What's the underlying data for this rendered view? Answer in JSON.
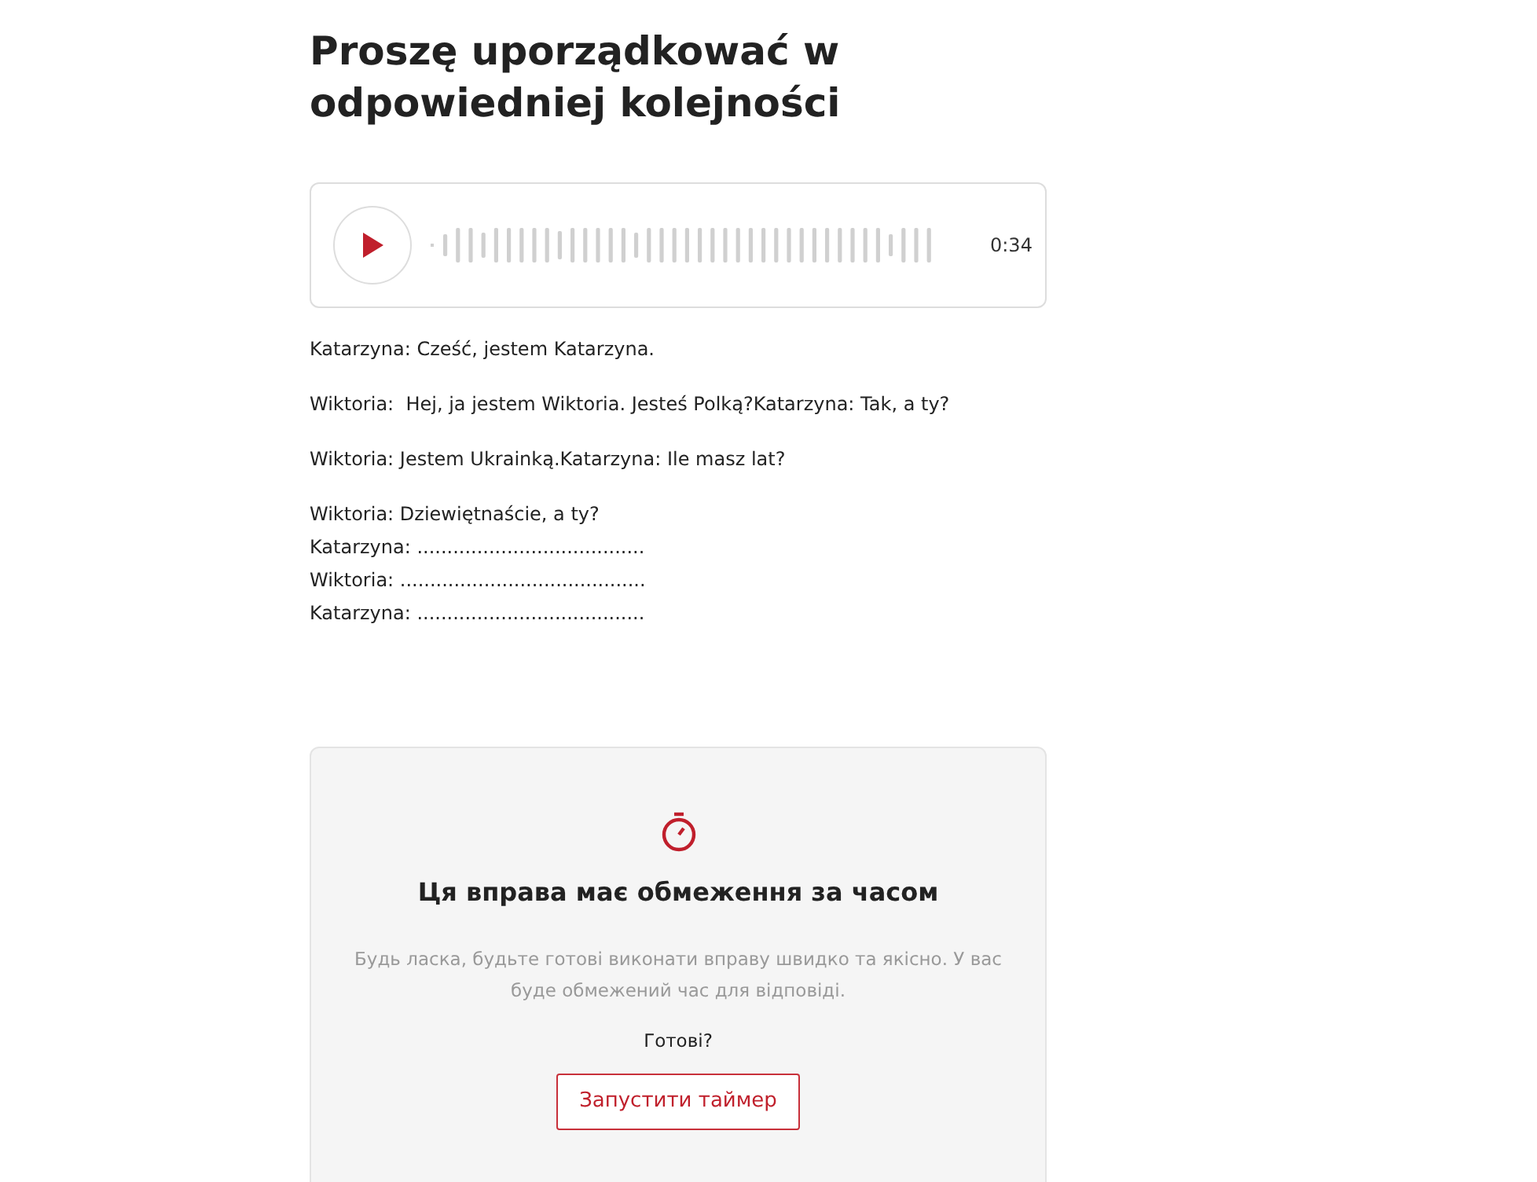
{
  "title": "Proszę uporządkować w odpowiedniej kolejności",
  "audio": {
    "duration": "0:34"
  },
  "paragraphs": [
    {
      "lines": [
        "Katarzyna: Cześć, jestem Katarzyna."
      ]
    },
    {
      "lines": [
        "Wiktoria:  Hej, ja jestem Wiktoria. Jesteś Polką?Katarzyna: Tak, a ty?"
      ]
    },
    {
      "lines": [
        "Wiktoria: Jestem Ukrainką.Katarzyna: Ile masz lat?"
      ]
    },
    {
      "lines": [
        "Wiktoria: Dziewiętnaście, a ty?",
        "Katarzyna: ......................................",
        "Wiktoria: .........................................",
        "Katarzyna: ......................................"
      ]
    }
  ],
  "timer_notice": {
    "heading": "Ця вправа має обмеження за часом",
    "description": "Будь ласка, будьте готові виконати вправу швидко та якісно. У вас буде обмежений час для відповіді.",
    "prompt": "Готові?",
    "button": "Запустити таймер"
  }
}
